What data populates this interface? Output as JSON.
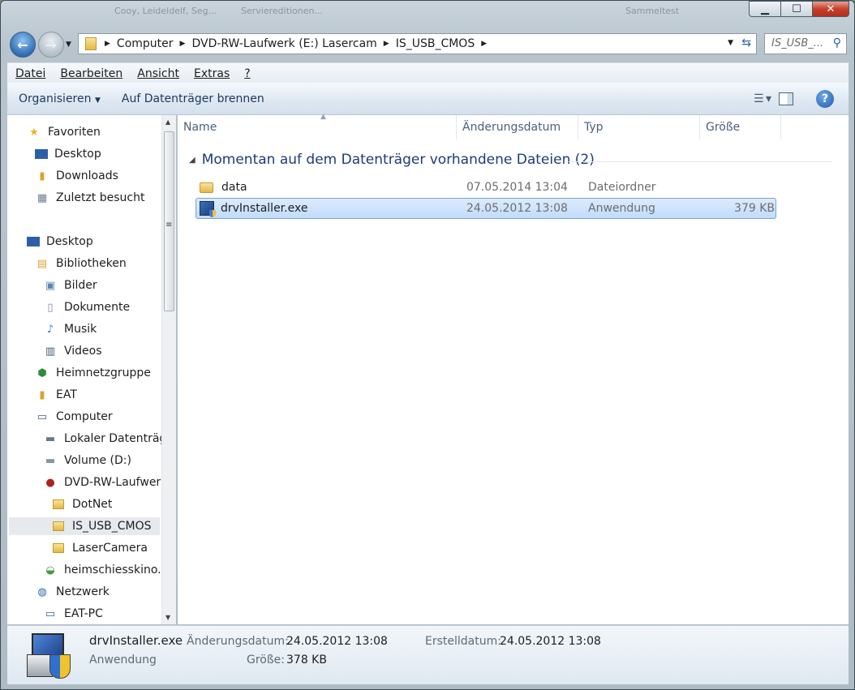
{
  "titlebar": {
    "blurred_fragments": [
      "Cooy, Leideldelf, Seg...",
      "Serviereditionen...",
      "Sammeltest"
    ],
    "buttons": {
      "minimize": "▁",
      "maximize": "☐",
      "close": "✕"
    }
  },
  "address": {
    "crumbs": [
      "Computer",
      "DVD-RW-Laufwerk (E:) Lasercam",
      "IS_USB_CMOS"
    ],
    "search_placeholder": "IS_USB_..."
  },
  "menu": [
    "Datei",
    "Bearbeiten",
    "Ansicht",
    "Extras",
    "?"
  ],
  "toolbar": {
    "organize": "Organisieren",
    "burn": "Auf Datenträger brennen"
  },
  "nav": {
    "favorites": "Favoriten",
    "desktop_fav": "Desktop",
    "downloads": "Downloads",
    "recent": "Zuletzt besucht",
    "desktop": "Desktop",
    "libraries": "Bibliotheken",
    "pictures": "Bilder",
    "documents": "Dokumente",
    "music": "Musik",
    "videos": "Videos",
    "homegroup": "Heimnetzgruppe",
    "eat": "EAT",
    "computer": "Computer",
    "local_disk": "Lokaler Datenträg",
    "volume_d": "Volume (D:)",
    "dvd": "DVD-RW-Laufwerk",
    "dotnet": "DotNet",
    "is_usb_cmos": "IS_USB_CMOS",
    "lasercamera": "LaserCamera",
    "heimschiess": "heimschiesskino.de",
    "network": "Netzwerk",
    "eat_pc": "EAT-PC"
  },
  "columns": {
    "name": "Name",
    "date": "Änderungsdatum",
    "type": "Typ",
    "size": "Größe"
  },
  "group": {
    "title": "Momentan auf dem Datenträger vorhandene Dateien (2)"
  },
  "files": [
    {
      "name": "data",
      "date": "07.05.2014 13:04",
      "type": "Dateiordner",
      "size": ""
    },
    {
      "name": "drvInstaller.exe",
      "date": "24.05.2012 13:08",
      "type": "Anwendung",
      "size": "379 KB"
    }
  ],
  "details": {
    "name": "drvInstaller.exe",
    "type": "Anwendung",
    "modified_label": "Änderungsdatum:",
    "modified": "24.05.2012 13:08",
    "created_label": "Erstelldatum:",
    "created": "24.05.2012 13:08",
    "size_label": "Größe:",
    "size": "378 KB"
  }
}
